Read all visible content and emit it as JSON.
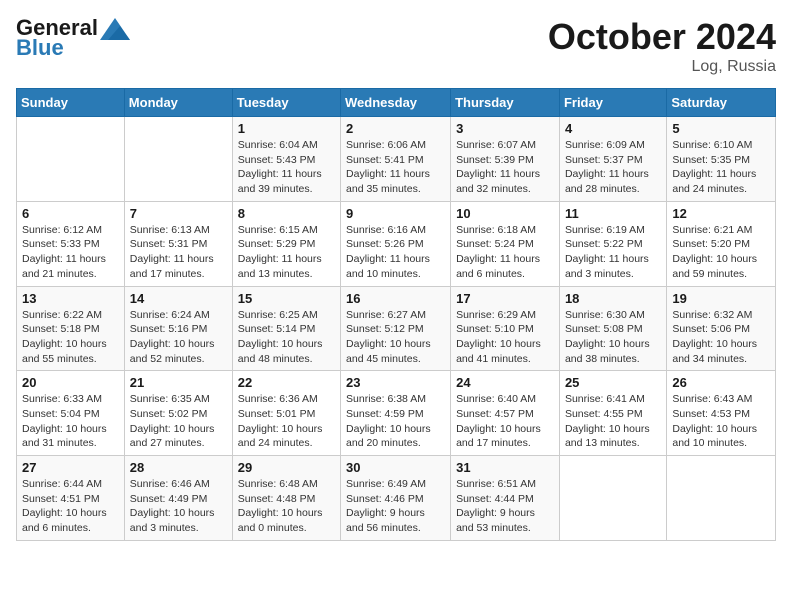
{
  "header": {
    "logo_line1": "General",
    "logo_line2": "Blue",
    "month_title": "October 2024",
    "location": "Log, Russia"
  },
  "weekdays": [
    "Sunday",
    "Monday",
    "Tuesday",
    "Wednesday",
    "Thursday",
    "Friday",
    "Saturday"
  ],
  "weeks": [
    [
      {
        "day": "",
        "info": ""
      },
      {
        "day": "",
        "info": ""
      },
      {
        "day": "1",
        "info": "Sunrise: 6:04 AM\nSunset: 5:43 PM\nDaylight: 11 hours and 39 minutes."
      },
      {
        "day": "2",
        "info": "Sunrise: 6:06 AM\nSunset: 5:41 PM\nDaylight: 11 hours and 35 minutes."
      },
      {
        "day": "3",
        "info": "Sunrise: 6:07 AM\nSunset: 5:39 PM\nDaylight: 11 hours and 32 minutes."
      },
      {
        "day": "4",
        "info": "Sunrise: 6:09 AM\nSunset: 5:37 PM\nDaylight: 11 hours and 28 minutes."
      },
      {
        "day": "5",
        "info": "Sunrise: 6:10 AM\nSunset: 5:35 PM\nDaylight: 11 hours and 24 minutes."
      }
    ],
    [
      {
        "day": "6",
        "info": "Sunrise: 6:12 AM\nSunset: 5:33 PM\nDaylight: 11 hours and 21 minutes."
      },
      {
        "day": "7",
        "info": "Sunrise: 6:13 AM\nSunset: 5:31 PM\nDaylight: 11 hours and 17 minutes."
      },
      {
        "day": "8",
        "info": "Sunrise: 6:15 AM\nSunset: 5:29 PM\nDaylight: 11 hours and 13 minutes."
      },
      {
        "day": "9",
        "info": "Sunrise: 6:16 AM\nSunset: 5:26 PM\nDaylight: 11 hours and 10 minutes."
      },
      {
        "day": "10",
        "info": "Sunrise: 6:18 AM\nSunset: 5:24 PM\nDaylight: 11 hours and 6 minutes."
      },
      {
        "day": "11",
        "info": "Sunrise: 6:19 AM\nSunset: 5:22 PM\nDaylight: 11 hours and 3 minutes."
      },
      {
        "day": "12",
        "info": "Sunrise: 6:21 AM\nSunset: 5:20 PM\nDaylight: 10 hours and 59 minutes."
      }
    ],
    [
      {
        "day": "13",
        "info": "Sunrise: 6:22 AM\nSunset: 5:18 PM\nDaylight: 10 hours and 55 minutes."
      },
      {
        "day": "14",
        "info": "Sunrise: 6:24 AM\nSunset: 5:16 PM\nDaylight: 10 hours and 52 minutes."
      },
      {
        "day": "15",
        "info": "Sunrise: 6:25 AM\nSunset: 5:14 PM\nDaylight: 10 hours and 48 minutes."
      },
      {
        "day": "16",
        "info": "Sunrise: 6:27 AM\nSunset: 5:12 PM\nDaylight: 10 hours and 45 minutes."
      },
      {
        "day": "17",
        "info": "Sunrise: 6:29 AM\nSunset: 5:10 PM\nDaylight: 10 hours and 41 minutes."
      },
      {
        "day": "18",
        "info": "Sunrise: 6:30 AM\nSunset: 5:08 PM\nDaylight: 10 hours and 38 minutes."
      },
      {
        "day": "19",
        "info": "Sunrise: 6:32 AM\nSunset: 5:06 PM\nDaylight: 10 hours and 34 minutes."
      }
    ],
    [
      {
        "day": "20",
        "info": "Sunrise: 6:33 AM\nSunset: 5:04 PM\nDaylight: 10 hours and 31 minutes."
      },
      {
        "day": "21",
        "info": "Sunrise: 6:35 AM\nSunset: 5:02 PM\nDaylight: 10 hours and 27 minutes."
      },
      {
        "day": "22",
        "info": "Sunrise: 6:36 AM\nSunset: 5:01 PM\nDaylight: 10 hours and 24 minutes."
      },
      {
        "day": "23",
        "info": "Sunrise: 6:38 AM\nSunset: 4:59 PM\nDaylight: 10 hours and 20 minutes."
      },
      {
        "day": "24",
        "info": "Sunrise: 6:40 AM\nSunset: 4:57 PM\nDaylight: 10 hours and 17 minutes."
      },
      {
        "day": "25",
        "info": "Sunrise: 6:41 AM\nSunset: 4:55 PM\nDaylight: 10 hours and 13 minutes."
      },
      {
        "day": "26",
        "info": "Sunrise: 6:43 AM\nSunset: 4:53 PM\nDaylight: 10 hours and 10 minutes."
      }
    ],
    [
      {
        "day": "27",
        "info": "Sunrise: 6:44 AM\nSunset: 4:51 PM\nDaylight: 10 hours and 6 minutes."
      },
      {
        "day": "28",
        "info": "Sunrise: 6:46 AM\nSunset: 4:49 PM\nDaylight: 10 hours and 3 minutes."
      },
      {
        "day": "29",
        "info": "Sunrise: 6:48 AM\nSunset: 4:48 PM\nDaylight: 10 hours and 0 minutes."
      },
      {
        "day": "30",
        "info": "Sunrise: 6:49 AM\nSunset: 4:46 PM\nDaylight: 9 hours and 56 minutes."
      },
      {
        "day": "31",
        "info": "Sunrise: 6:51 AM\nSunset: 4:44 PM\nDaylight: 9 hours and 53 minutes."
      },
      {
        "day": "",
        "info": ""
      },
      {
        "day": "",
        "info": ""
      }
    ]
  ]
}
